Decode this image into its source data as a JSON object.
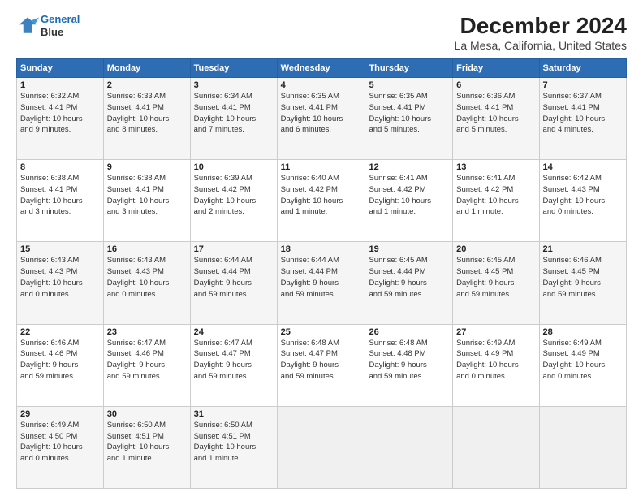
{
  "logo": {
    "line1": "General",
    "line2": "Blue"
  },
  "title": "December 2024",
  "subtitle": "La Mesa, California, United States",
  "days_of_week": [
    "Sunday",
    "Monday",
    "Tuesday",
    "Wednesday",
    "Thursday",
    "Friday",
    "Saturday"
  ],
  "weeks": [
    [
      {
        "day": "1",
        "info": "Sunrise: 6:32 AM\nSunset: 4:41 PM\nDaylight: 10 hours\nand 9 minutes."
      },
      {
        "day": "2",
        "info": "Sunrise: 6:33 AM\nSunset: 4:41 PM\nDaylight: 10 hours\nand 8 minutes."
      },
      {
        "day": "3",
        "info": "Sunrise: 6:34 AM\nSunset: 4:41 PM\nDaylight: 10 hours\nand 7 minutes."
      },
      {
        "day": "4",
        "info": "Sunrise: 6:35 AM\nSunset: 4:41 PM\nDaylight: 10 hours\nand 6 minutes."
      },
      {
        "day": "5",
        "info": "Sunrise: 6:35 AM\nSunset: 4:41 PM\nDaylight: 10 hours\nand 5 minutes."
      },
      {
        "day": "6",
        "info": "Sunrise: 6:36 AM\nSunset: 4:41 PM\nDaylight: 10 hours\nand 5 minutes."
      },
      {
        "day": "7",
        "info": "Sunrise: 6:37 AM\nSunset: 4:41 PM\nDaylight: 10 hours\nand 4 minutes."
      }
    ],
    [
      {
        "day": "8",
        "info": "Sunrise: 6:38 AM\nSunset: 4:41 PM\nDaylight: 10 hours\nand 3 minutes."
      },
      {
        "day": "9",
        "info": "Sunrise: 6:38 AM\nSunset: 4:41 PM\nDaylight: 10 hours\nand 3 minutes."
      },
      {
        "day": "10",
        "info": "Sunrise: 6:39 AM\nSunset: 4:42 PM\nDaylight: 10 hours\nand 2 minutes."
      },
      {
        "day": "11",
        "info": "Sunrise: 6:40 AM\nSunset: 4:42 PM\nDaylight: 10 hours\nand 1 minute."
      },
      {
        "day": "12",
        "info": "Sunrise: 6:41 AM\nSunset: 4:42 PM\nDaylight: 10 hours\nand 1 minute."
      },
      {
        "day": "13",
        "info": "Sunrise: 6:41 AM\nSunset: 4:42 PM\nDaylight: 10 hours\nand 1 minute."
      },
      {
        "day": "14",
        "info": "Sunrise: 6:42 AM\nSunset: 4:43 PM\nDaylight: 10 hours\nand 0 minutes."
      }
    ],
    [
      {
        "day": "15",
        "info": "Sunrise: 6:43 AM\nSunset: 4:43 PM\nDaylight: 10 hours\nand 0 minutes."
      },
      {
        "day": "16",
        "info": "Sunrise: 6:43 AM\nSunset: 4:43 PM\nDaylight: 10 hours\nand 0 minutes."
      },
      {
        "day": "17",
        "info": "Sunrise: 6:44 AM\nSunset: 4:44 PM\nDaylight: 9 hours\nand 59 minutes."
      },
      {
        "day": "18",
        "info": "Sunrise: 6:44 AM\nSunset: 4:44 PM\nDaylight: 9 hours\nand 59 minutes."
      },
      {
        "day": "19",
        "info": "Sunrise: 6:45 AM\nSunset: 4:44 PM\nDaylight: 9 hours\nand 59 minutes."
      },
      {
        "day": "20",
        "info": "Sunrise: 6:45 AM\nSunset: 4:45 PM\nDaylight: 9 hours\nand 59 minutes."
      },
      {
        "day": "21",
        "info": "Sunrise: 6:46 AM\nSunset: 4:45 PM\nDaylight: 9 hours\nand 59 minutes."
      }
    ],
    [
      {
        "day": "22",
        "info": "Sunrise: 6:46 AM\nSunset: 4:46 PM\nDaylight: 9 hours\nand 59 minutes."
      },
      {
        "day": "23",
        "info": "Sunrise: 6:47 AM\nSunset: 4:46 PM\nDaylight: 9 hours\nand 59 minutes."
      },
      {
        "day": "24",
        "info": "Sunrise: 6:47 AM\nSunset: 4:47 PM\nDaylight: 9 hours\nand 59 minutes."
      },
      {
        "day": "25",
        "info": "Sunrise: 6:48 AM\nSunset: 4:47 PM\nDaylight: 9 hours\nand 59 minutes."
      },
      {
        "day": "26",
        "info": "Sunrise: 6:48 AM\nSunset: 4:48 PM\nDaylight: 9 hours\nand 59 minutes."
      },
      {
        "day": "27",
        "info": "Sunrise: 6:49 AM\nSunset: 4:49 PM\nDaylight: 10 hours\nand 0 minutes."
      },
      {
        "day": "28",
        "info": "Sunrise: 6:49 AM\nSunset: 4:49 PM\nDaylight: 10 hours\nand 0 minutes."
      }
    ],
    [
      {
        "day": "29",
        "info": "Sunrise: 6:49 AM\nSunset: 4:50 PM\nDaylight: 10 hours\nand 0 minutes."
      },
      {
        "day": "30",
        "info": "Sunrise: 6:50 AM\nSunset: 4:51 PM\nDaylight: 10 hours\nand 1 minute."
      },
      {
        "day": "31",
        "info": "Sunrise: 6:50 AM\nSunset: 4:51 PM\nDaylight: 10 hours\nand 1 minute."
      },
      {
        "day": "",
        "info": ""
      },
      {
        "day": "",
        "info": ""
      },
      {
        "day": "",
        "info": ""
      },
      {
        "day": "",
        "info": ""
      }
    ]
  ]
}
